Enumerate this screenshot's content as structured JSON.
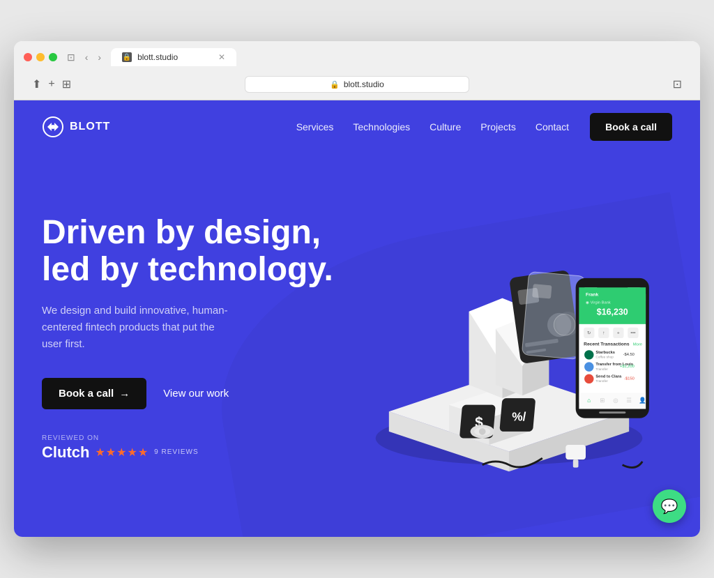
{
  "browser": {
    "url": "blott.studio",
    "tab_title": "blott.studio",
    "favicon": "b"
  },
  "navbar": {
    "logo_text": "BLOTT",
    "nav_links": [
      {
        "label": "Services",
        "href": "#"
      },
      {
        "label": "Technologies",
        "href": "#"
      },
      {
        "label": "Culture",
        "href": "#"
      },
      {
        "label": "Projects",
        "href": "#"
      },
      {
        "label": "Contact",
        "href": "#"
      }
    ],
    "cta_label": "Book a call"
  },
  "hero": {
    "headline_line1": "Driven by design,",
    "headline_line2": "led by technology.",
    "subtext": "We design and build innovative, human-centered fintech products that put the user first.",
    "btn_primary": "Book a call",
    "btn_arrow": "→",
    "btn_secondary": "View our work",
    "clutch_reviewed_label": "REVIEWED ON",
    "clutch_name": "Clutch",
    "stars": "★★★★★",
    "reviews_label": "9 REVIEWS"
  },
  "chat": {
    "icon": "💬"
  },
  "colors": {
    "background": "#4040e0",
    "nav_cta_bg": "#111111",
    "btn_primary_bg": "#111111",
    "chat_bg": "#3ddc84",
    "stars_color": "#ff6b2b"
  }
}
